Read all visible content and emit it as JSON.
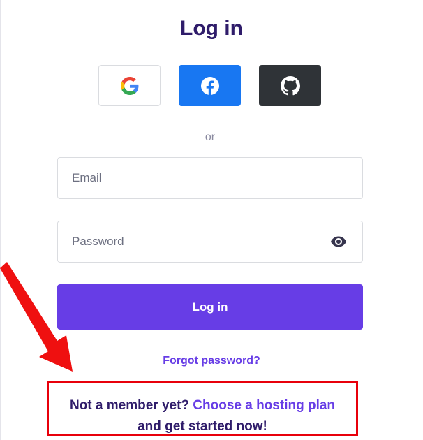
{
  "login": {
    "title": "Log in",
    "divider_text": "or",
    "email_placeholder": "Email",
    "password_placeholder": "Password",
    "submit_label": "Log in",
    "forgot_label": "Forgot password?"
  },
  "social": {
    "google_icon": "google-icon",
    "facebook_icon": "facebook-icon",
    "github_icon": "github-icon"
  },
  "signup": {
    "prefix": "Not a member yet?",
    "link": "Choose a hosting plan",
    "suffix": "and get started now!"
  },
  "colors": {
    "accent": "#673de6",
    "title": "#2f1c6a",
    "facebook": "#1877f2",
    "github": "#2f3337",
    "highlight": "#e8000b"
  }
}
